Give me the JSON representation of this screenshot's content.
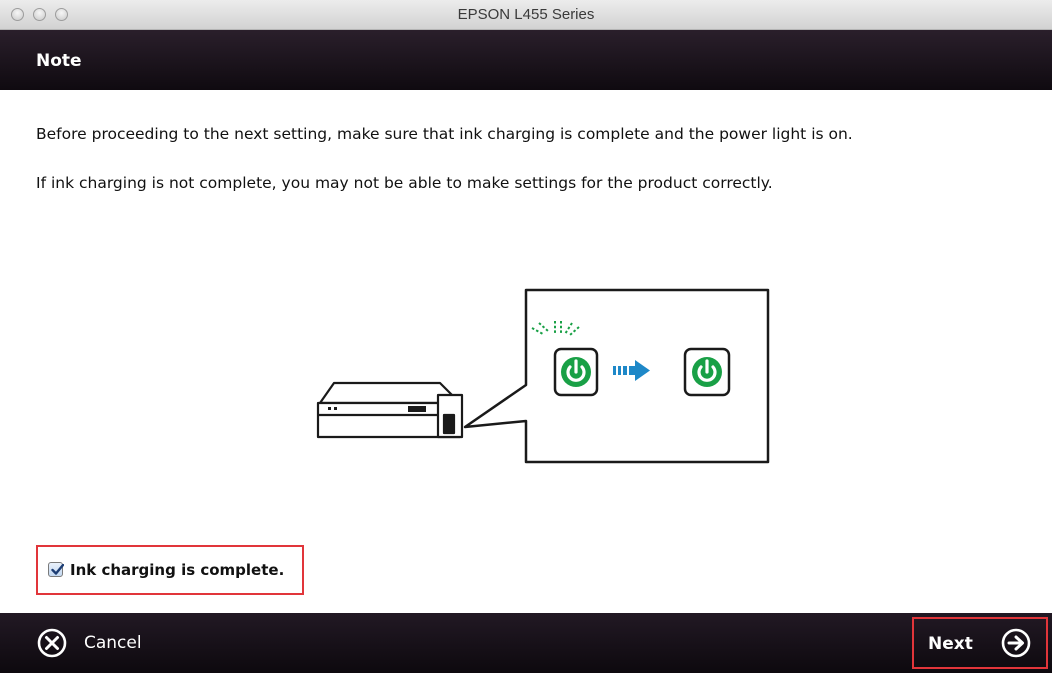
{
  "window": {
    "title": "EPSON L455 Series"
  },
  "header": {
    "title": "Note"
  },
  "body": {
    "paragraph1": "Before proceeding to the next setting, make sure that ink charging is complete and the power light is on.",
    "paragraph2": "If ink charging is not complete, you may not be able to make settings for the product correctly."
  },
  "checkbox": {
    "label": "Ink charging is complete.",
    "checked": true
  },
  "footer": {
    "cancel_label": "Cancel",
    "next_label": "Next"
  },
  "colors": {
    "power_green": "#19a046",
    "arrow_blue": "#1e88c8",
    "highlight_red": "#e1353a",
    "bar_dark": "#1a131b"
  }
}
